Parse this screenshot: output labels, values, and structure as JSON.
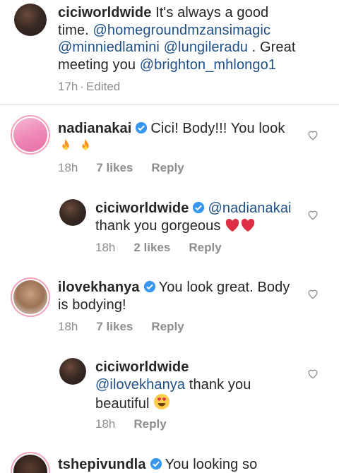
{
  "caption": {
    "username": "ciciworldwide",
    "text_1": " It's always a good time. ",
    "mention_1": "@homegroundmzansimagic",
    "mention_2": "@minniedlamini",
    "mention_3": "@lungileradu",
    "text_2": " . Great meeting you ",
    "mention_4": "@brighton_mhlongo1",
    "time": "17h",
    "edited": "Edited"
  },
  "comments": [
    {
      "username": "nadianakai",
      "text": "Cici! Body!!! You look",
      "emoji": "fire fire",
      "time": "18h",
      "likes": "7 likes",
      "reply": "Reply"
    },
    {
      "username": "ciciworldwide",
      "mention": "@nadianakai",
      "text": "thank you gorgeous",
      "emoji": "heart heart",
      "time": "18h",
      "likes": "2 likes",
      "reply": "Reply"
    },
    {
      "username": "ilovekhanya",
      "text": "You look great. Body is bodying!",
      "time": "18h",
      "likes": "7 likes",
      "reply": "Reply"
    },
    {
      "username": "ciciworldwide",
      "mention": "@ilovekhanya",
      "text": " thank you beautiful",
      "emoji": "heart-eyes",
      "time": "18h",
      "reply": "Reply"
    },
    {
      "username": "tshepivundla",
      "text": "You looking so"
    }
  ],
  "colors": {
    "mention": "#1f4f86",
    "verified": "#3897f0",
    "meta": "#8e8e8e",
    "story_ring": "#f5a3b8"
  }
}
